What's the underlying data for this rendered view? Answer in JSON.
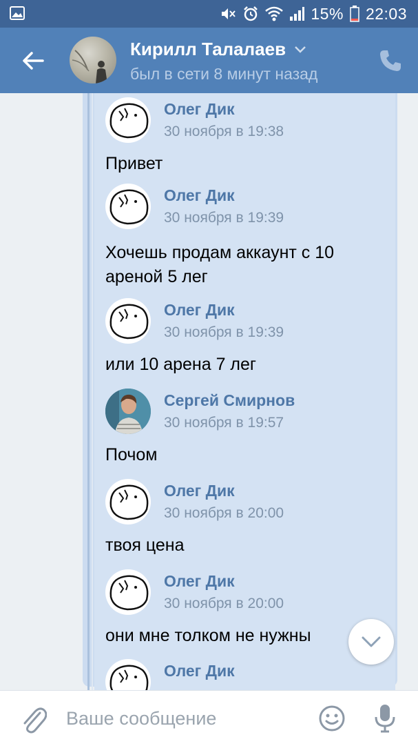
{
  "status_bar": {
    "battery": "15%",
    "time": "22:03",
    "icons": [
      "image-icon",
      "mute-icon",
      "alarm-icon",
      "wifi-icon",
      "signal-icon",
      "battery-icon"
    ]
  },
  "header": {
    "title": "Кирилл Талалаев",
    "subtitle": "был в сети 8 минут назад",
    "icons": [
      "back-arrow-icon",
      "chevron-down-icon",
      "phone-icon"
    ]
  },
  "messages": [
    {
      "author": "Олег Дик",
      "date": "30 ноября в 19:38",
      "text": "Привет",
      "avatar": "meme-face"
    },
    {
      "author": "Олег Дик",
      "date": "30 ноября в 19:39",
      "text": "Хочешь продам аккаунт с 10 ареной 5 лег",
      "avatar": "meme-face"
    },
    {
      "author": "Олег Дик",
      "date": "30 ноября в 19:39",
      "text": "или 10 арена 7 лег",
      "avatar": "meme-face"
    },
    {
      "author": "Сергей Смирнов",
      "date": "30 ноября в 19:57",
      "text": "Почом",
      "avatar": "photo"
    },
    {
      "author": "Олег Дик",
      "date": "30 ноября в 20:00",
      "text": "твоя цена",
      "avatar": "meme-face"
    },
    {
      "author": "Олег Дик",
      "date": "30 ноября в 20:00",
      "text": "они мне толком не нужны",
      "avatar": "meme-face"
    },
    {
      "author": "Олег Дик",
      "avatar": "meme-face"
    }
  ],
  "composer": {
    "placeholder": "Ваше сообщение",
    "icons": [
      "paperclip-icon",
      "emoji-icon",
      "microphone-icon"
    ]
  },
  "colors": {
    "status_bar": "#3e6496",
    "header": "#5181b8",
    "bubble": "#d4e2f3",
    "author": "#4e77a7"
  }
}
